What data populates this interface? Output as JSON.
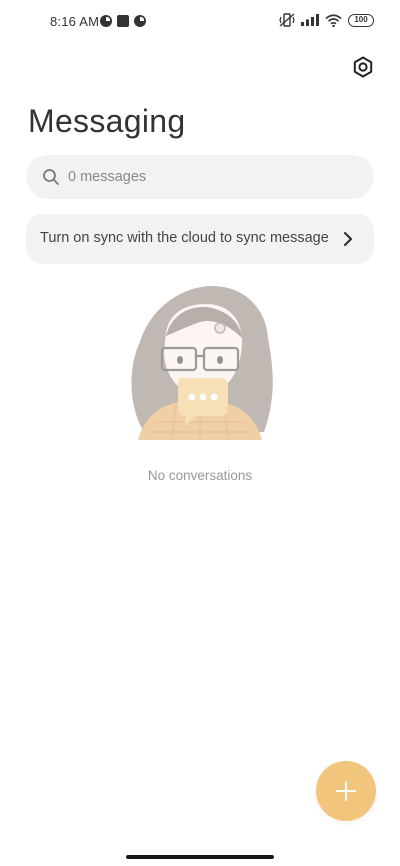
{
  "status_bar": {
    "time": "8:16 AM",
    "battery": "100",
    "icons": [
      "data-saver-icon",
      "square-icon",
      "data-saver-icon",
      "vibrate-icon",
      "signal-icon",
      "wifi-icon",
      "battery-icon"
    ]
  },
  "header": {
    "title": "Messaging",
    "settings_icon": "settings-icon"
  },
  "search": {
    "placeholder": "0 messages",
    "icon": "search-icon"
  },
  "sync_banner": {
    "text": "Turn on sync with the cloud to sync messages",
    "icon": "chevron-right-icon"
  },
  "empty_state": {
    "text": "No conversations",
    "illustration": "girl-with-chat-bubble-illustration"
  },
  "fab": {
    "icon": "plus-icon",
    "color": "#f2c57d"
  },
  "colors": {
    "accent": "#f2c57d",
    "surface": "#f2f2f2",
    "background": "#ffffff"
  }
}
